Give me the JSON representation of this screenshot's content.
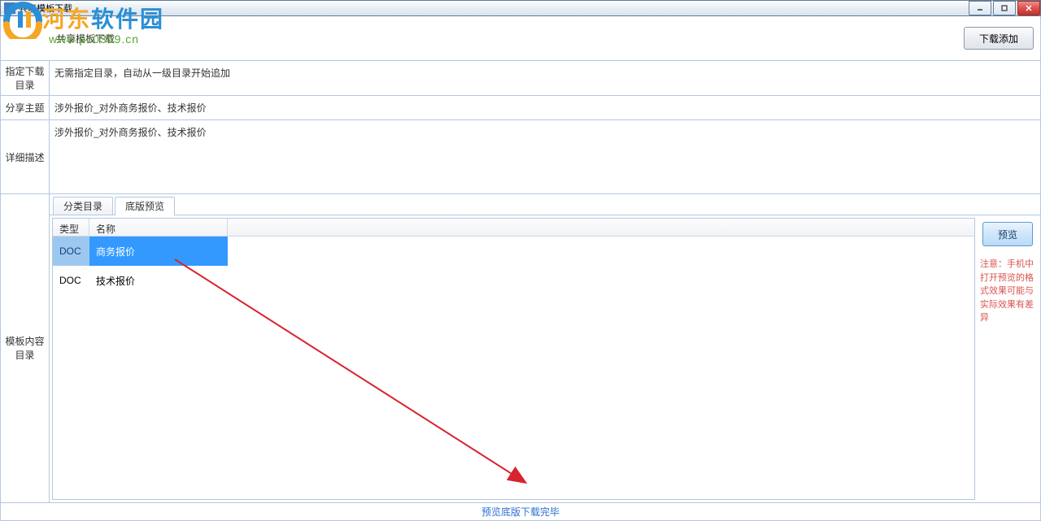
{
  "window": {
    "title": "共享模板下载"
  },
  "watermark": {
    "brand1": "河东",
    "brand2": "软件园",
    "url": "www.pc0359.cn"
  },
  "toolbar": {
    "title": "共享模板下载",
    "download_add": "下载添加"
  },
  "fields": {
    "dir_label": "指定下载目录",
    "dir_value": "无需指定目录，自动从一级目录开始追加",
    "topic_label": "分享主题",
    "topic_value": "涉外报价_对外商务报价、技术报价",
    "desc_label": "详细描述",
    "desc_value": "涉外报价_对外商务报价、技术报价"
  },
  "content": {
    "label": "模板内容目录",
    "tabs": {
      "catalog": "分类目录",
      "preview": "底版预览"
    },
    "grid": {
      "headers": {
        "type": "类型",
        "name": "名称"
      },
      "rows": [
        {
          "type": "DOC",
          "name": "商务报价",
          "selected": true
        },
        {
          "type": "DOC",
          "name": "技术报价",
          "selected": false
        }
      ]
    },
    "side": {
      "preview_btn": "预览",
      "warn": "注意：手机中打开预览的格式效果可能与实际效果有差异"
    }
  },
  "status": "预览底版下载完毕"
}
